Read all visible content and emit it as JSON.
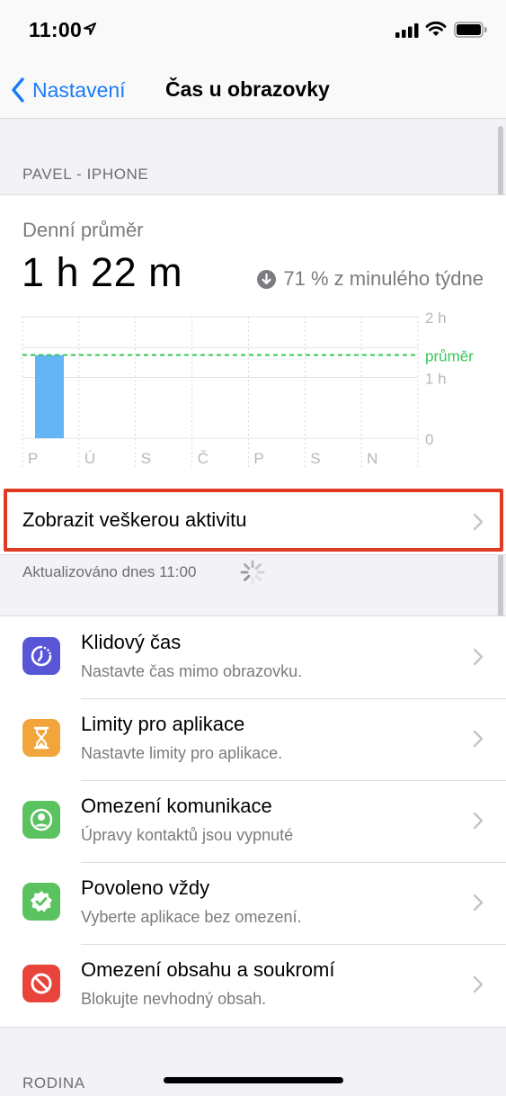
{
  "status": {
    "time": "11:00"
  },
  "nav": {
    "back_label": "Nastavení",
    "title": "Čas u obrazovky"
  },
  "section_device": "PAVEL - IPHONE",
  "summary": {
    "label": "Denní průměr",
    "value": "1 h 22 m",
    "change": "71 % z minulého týdne"
  },
  "chart_data": {
    "type": "bar",
    "categories": [
      "P",
      "Ú",
      "S",
      "Č",
      "P",
      "S",
      "N"
    ],
    "values_hours": [
      1.37,
      0,
      0,
      0,
      0,
      0,
      0
    ],
    "average_hours": 1.37,
    "y_tick_labels": [
      "2 h",
      "1 h",
      "0"
    ],
    "average_label": "průměr",
    "ylim": [
      0,
      2
    ],
    "bar_color": "#64b5f6",
    "average_color": "#34c759"
  },
  "activity": {
    "label": "Zobrazit veškerou aktivitu"
  },
  "updated": "Aktualizováno dnes 11:00",
  "items": [
    {
      "title": "Klidový čas",
      "subtitle": "Nastavte čas mimo obrazovku.",
      "icon": "downtime-icon",
      "color": "#5856d6"
    },
    {
      "title": "Limity pro aplikace",
      "subtitle": "Nastavte limity pro aplikace.",
      "icon": "hourglass-icon",
      "color": "#f2a53a"
    },
    {
      "title": "Omezení komunikace",
      "subtitle": "Úpravy kontaktů jsou vypnuté",
      "icon": "contact-icon",
      "color": "#5ac360"
    },
    {
      "title": "Povoleno vždy",
      "subtitle": "Vyberte aplikace bez omezení.",
      "icon": "checkmark-badge-icon",
      "color": "#5ac360"
    },
    {
      "title": "Omezení obsahu a soukromí",
      "subtitle": "Blokujte nevhodný obsah.",
      "icon": "restriction-icon",
      "color": "#e9443b"
    }
  ],
  "section_family": "RODINA"
}
